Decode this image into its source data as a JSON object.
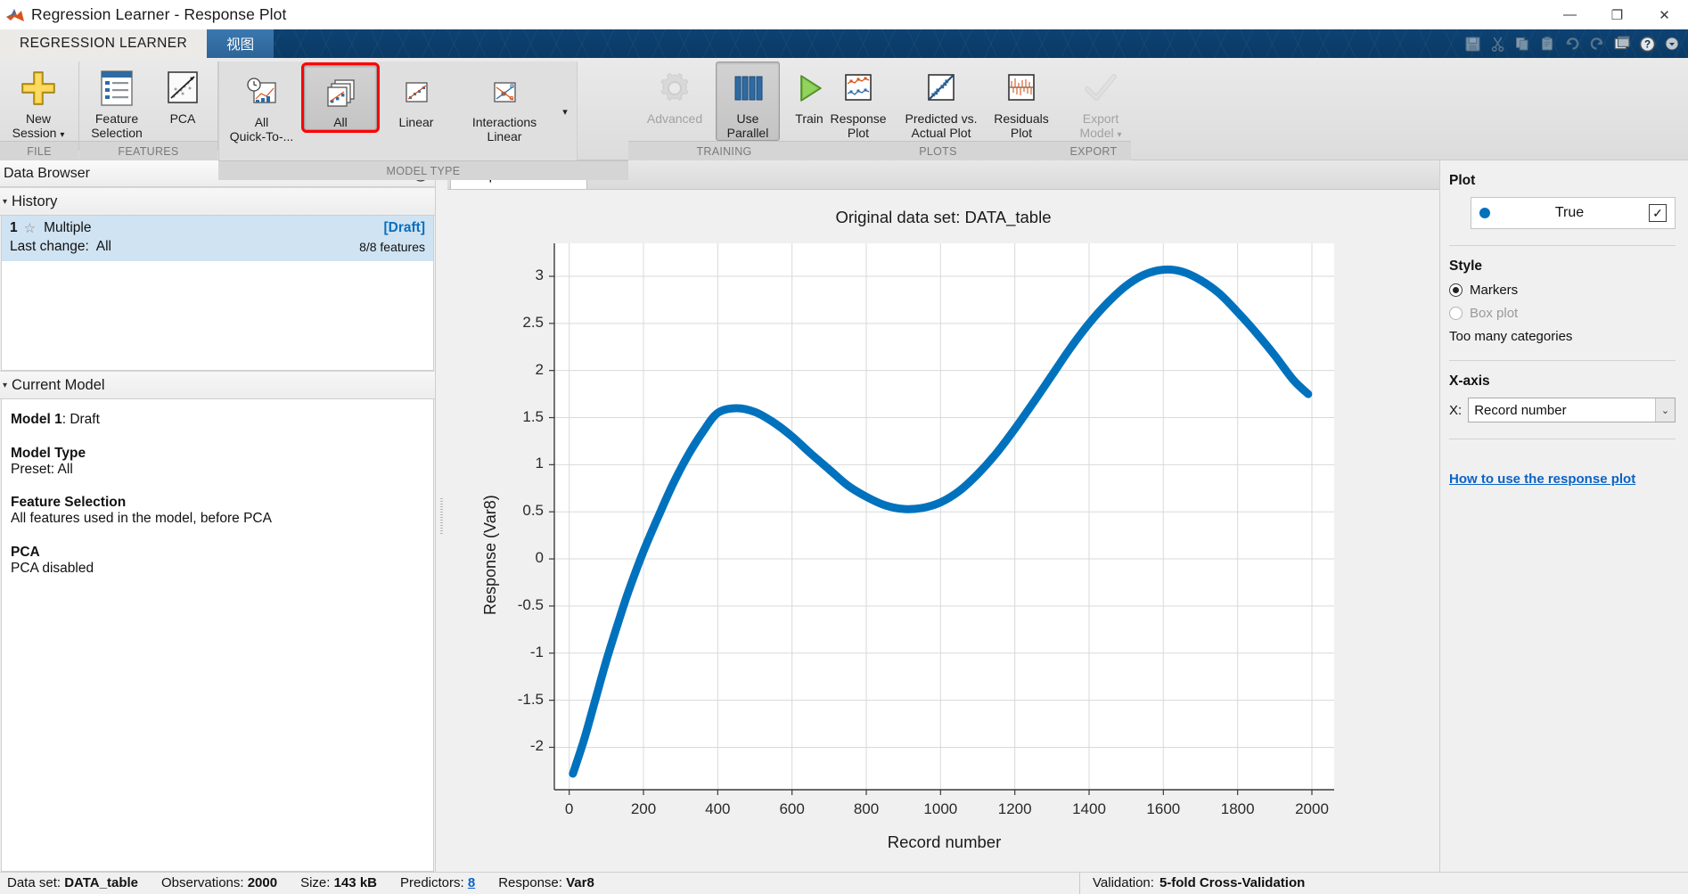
{
  "window": {
    "title": "Regression Learner - Response Plot",
    "minimize": "—",
    "restore": "❐",
    "close": "✕"
  },
  "ribbon_tabs": {
    "main": "REGRESSION LEARNER",
    "view": "视图"
  },
  "quick_access": [
    {
      "name": "save-icon",
      "glyph": "💾",
      "enabled": false
    },
    {
      "name": "cut-icon",
      "glyph": "✂",
      "enabled": false
    },
    {
      "name": "copy-icon",
      "glyph": "⧉",
      "enabled": false
    },
    {
      "name": "paste-icon",
      "glyph": "📋",
      "enabled": false
    },
    {
      "name": "undo-icon",
      "glyph": "↶",
      "enabled": false
    },
    {
      "name": "redo-icon",
      "glyph": "↷",
      "enabled": false
    },
    {
      "name": "layout-icon",
      "glyph": "❐",
      "enabled": true
    },
    {
      "name": "help-icon",
      "glyph": "?",
      "enabled": true
    },
    {
      "name": "more-icon",
      "glyph": "▾",
      "enabled": true
    }
  ],
  "ribbon_groups": [
    {
      "label": "FILE"
    },
    {
      "label": "FEATURES"
    },
    {
      "label": "MODEL TYPE"
    },
    {
      "label": "TRAINING"
    },
    {
      "label": "PLOTS"
    },
    {
      "label": "EXPORT"
    }
  ],
  "ribbon_buttons": {
    "new_session": {
      "line1": "New",
      "line2": "Session",
      "caret": "▾"
    },
    "feature_selection": {
      "line1": "Feature",
      "line2": "Selection"
    },
    "pca": {
      "line1": "PCA",
      "line2": ""
    },
    "all_quick": {
      "line1": "All",
      "line2": "Quick-To-..."
    },
    "all": {
      "line1": "All",
      "line2": ""
    },
    "linear": {
      "line1": "Linear",
      "line2": ""
    },
    "interactions_linear": {
      "line1": "Interactions",
      "line2": "Linear"
    },
    "more_models": {
      "caret": "▾"
    },
    "advanced": {
      "line1": "Advanced",
      "line2": ""
    },
    "use_parallel": {
      "line1": "Use",
      "line2": "Parallel"
    },
    "train": {
      "line1": "Train",
      "line2": ""
    },
    "response_plot": {
      "line1": "Response",
      "line2": "Plot"
    },
    "predicted_vs_actual": {
      "line1": "Predicted vs.",
      "line2": "Actual Plot"
    },
    "residuals_plot": {
      "line1": "Residuals",
      "line2": "Plot"
    },
    "export_model": {
      "line1": "Export",
      "line2": "Model",
      "caret": "▾"
    }
  },
  "data_browser": {
    "title": "Data Browser",
    "collapse_icon": "▼",
    "history": {
      "title": "History",
      "tri": "▾",
      "rows": [
        {
          "number": "1",
          "star": "☆",
          "name": "Multiple",
          "status": "[Draft]",
          "last_change_label": "Last change:",
          "last_change_value": "All",
          "features": "8/8 features"
        }
      ]
    },
    "current_model": {
      "title": "Current Model",
      "tri": "▾",
      "blocks": [
        {
          "heading": "Model 1",
          "heading_suffix": ": Draft",
          "body": ""
        },
        {
          "heading": "Model Type",
          "heading_suffix": "",
          "body": "Preset: All"
        },
        {
          "heading": "Feature Selection",
          "heading_suffix": "",
          "body": "All features used in the model, before PCA"
        },
        {
          "heading": "PCA",
          "heading_suffix": "",
          "body": "PCA disabled"
        }
      ]
    }
  },
  "document_tab": {
    "label": "Response Plot",
    "close_glyph": "✕"
  },
  "chart_data": {
    "type": "line",
    "title": "Original data set: DATA_table",
    "xlabel": "Record number",
    "ylabel": "Response (Var8)",
    "xlim": [
      -40,
      2060
    ],
    "ylim": [
      -2.45,
      3.35
    ],
    "xticks": [
      0,
      200,
      400,
      600,
      800,
      1000,
      1200,
      1400,
      1600,
      1800,
      2000
    ],
    "xticklabels": [
      "0",
      "200",
      "400",
      "600",
      "800",
      "1000",
      "1200",
      "1400",
      "1600",
      "1800",
      "2000"
    ],
    "yticks": [
      3,
      2.5,
      2,
      1.5,
      1,
      0.5,
      0,
      -0.5,
      -1,
      -1.5,
      -2
    ],
    "yticklabels": [
      "3",
      "2.5",
      "2",
      "1.5",
      "1",
      "0.5",
      "0",
      "-0.5",
      "-1",
      "-1.5",
      "-2"
    ],
    "grid": true,
    "legend_position": "external-right",
    "series": [
      {
        "name": "True",
        "color": "#0072bd",
        "marker": "dot",
        "linewidth": 9,
        "x": [
          10,
          40,
          70,
          100,
          130,
          160,
          200,
          240,
          280,
          320,
          360,
          400,
          450,
          500,
          550,
          600,
          650,
          700,
          750,
          800,
          850,
          900,
          950,
          1000,
          1050,
          1100,
          1150,
          1200,
          1250,
          1300,
          1350,
          1400,
          1450,
          1500,
          1550,
          1600,
          1650,
          1700,
          1750,
          1800,
          1850,
          1900,
          1950,
          1990
        ],
        "y": [
          -2.28,
          -1.92,
          -1.5,
          -1.08,
          -0.7,
          -0.34,
          0.08,
          0.45,
          0.8,
          1.1,
          1.35,
          1.55,
          1.6,
          1.56,
          1.45,
          1.3,
          1.12,
          0.95,
          0.78,
          0.66,
          0.57,
          0.53,
          0.54,
          0.6,
          0.72,
          0.9,
          1.12,
          1.38,
          1.66,
          1.95,
          2.24,
          2.5,
          2.72,
          2.9,
          3.02,
          3.07,
          3.05,
          2.96,
          2.82,
          2.62,
          2.4,
          2.16,
          1.9,
          1.75
        ]
      }
    ]
  },
  "plot_panel": {
    "plot_heading": "Plot",
    "legend": {
      "label": "True",
      "color": "#0072bd",
      "checked": true,
      "check_glyph": "✓"
    },
    "style_heading": "Style",
    "style_options": [
      {
        "label": "Markers",
        "selected": true,
        "enabled": true
      },
      {
        "label": "Box plot",
        "selected": false,
        "enabled": false
      }
    ],
    "style_note": "Too many categories",
    "xaxis_heading": "X-axis",
    "x_label": "X:",
    "x_value": "Record number",
    "x_arrow": "⌄",
    "help_link": "How to use the response plot"
  },
  "status_bar": {
    "items": [
      {
        "label": "Data set:",
        "value": "DATA_table",
        "link": false
      },
      {
        "label": "Observations:",
        "value": "2000",
        "link": false
      },
      {
        "label": "Size:",
        "value": "143 kB",
        "link": false
      },
      {
        "label": "Predictors:",
        "value": "8",
        "link": true
      },
      {
        "label": "Response:",
        "value": "Var8",
        "link": false
      }
    ],
    "validation_label": "Validation:",
    "validation_value": "5-fold Cross-Validation"
  }
}
